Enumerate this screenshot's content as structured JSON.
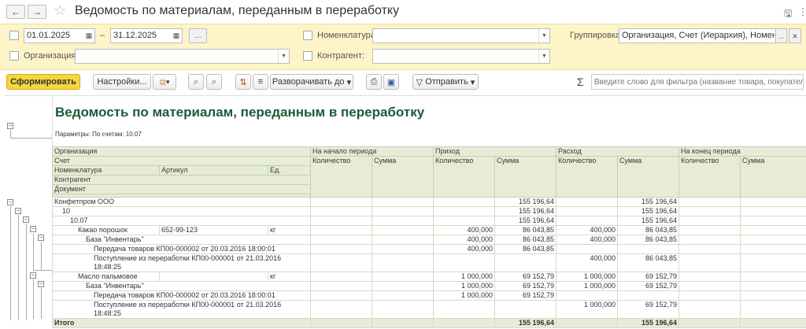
{
  "window": {
    "title": "Ведомость по материалам, переданным в переработку",
    "back_icon": "←",
    "forward_icon": "→",
    "star_icon": "☆",
    "save_icon": "🖫",
    "more_icon": "⋮"
  },
  "filters": {
    "date_from": "01.01.2025",
    "dash": "–",
    "date_to": "31.12.2025",
    "period_button": "...",
    "org_label": "Организация:",
    "org_value": "",
    "nom_label": "Номенклатура:",
    "nom_value": "",
    "contractor_label": "Контрагент:",
    "contractor_value": "",
    "grouping_label": "Группировка:",
    "grouping_value": "Организация, Счет (Иерархия), Номенклат",
    "grouping_btn": "...",
    "grouping_clear": "×"
  },
  "toolbar": {
    "generate": "Сформировать",
    "settings": "Настройки...",
    "expand": "Разворачивать до",
    "send": "Отправить",
    "sigma": "Σ",
    "search_placeholder": "Введите слово для фильтра (название товара, покупателя и"
  },
  "report": {
    "title": "Ведомость по материалам, переданным в переработку",
    "params": "Параметры: По счетам: 10.07",
    "header": {
      "org": "Организация",
      "account": "Счет",
      "nom": "Номенклатура",
      "article": "Артикул",
      "unit": "Ед.",
      "contractor": "Контрагент",
      "document": "Документ",
      "start": "На начало периода",
      "income": "Приход",
      "expense": "Расход",
      "end": "На конец периода",
      "qty": "Количество",
      "sum": "Сумма"
    },
    "rows": [
      {
        "label": "Конфетпром ООО",
        "article": "",
        "unit": "",
        "iq": "",
        "is": "155 196,64",
        "eq": "",
        "es": "155 196,64"
      },
      {
        "label": "10",
        "article": "",
        "unit": "",
        "iq": "",
        "is": "155 196,64",
        "eq": "",
        "es": "155 196,64"
      },
      {
        "label": "10.07",
        "article": "",
        "unit": "",
        "iq": "",
        "is": "155 196,64",
        "eq": "",
        "es": "155 196,64"
      },
      {
        "label": "Какао порошок",
        "article": "652-99-123",
        "unit": "кг",
        "iq": "400,000",
        "is": "86 043,85",
        "eq": "400,000",
        "es": "86 043,85"
      },
      {
        "label": "База \"Инвентарь\"",
        "article": "",
        "unit": "",
        "iq": "400,000",
        "is": "86 043,85",
        "eq": "400,000",
        "es": "86 043,85"
      },
      {
        "label": "Передача товаров КП00-000002 от 20.03.2016 18:00:01",
        "article": "",
        "unit": "",
        "iq": "400,000",
        "is": "86 043,85",
        "eq": "",
        "es": ""
      },
      {
        "label": "Поступление из переработки КП00-000001 от 21.03.2016",
        "label2": "18:48:25",
        "article": "",
        "unit": "",
        "iq": "",
        "is": "",
        "eq": "400,000",
        "es": "86 043,85"
      },
      {
        "label": "Масло пальмовое",
        "article": "",
        "unit": "кг",
        "iq": "1 000,000",
        "is": "69 152,79",
        "eq": "1 000,000",
        "es": "69 152,79"
      },
      {
        "label": "База \"Инвентарь\"",
        "article": "",
        "unit": "",
        "iq": "1 000,000",
        "is": "69 152,79",
        "eq": "1 000,000",
        "es": "69 152,79"
      },
      {
        "label": "Передача товаров КП00-000002 от 20.03.2016 18:00:01",
        "article": "",
        "unit": "",
        "iq": "1 000,000",
        "is": "69 152,79",
        "eq": "",
        "es": ""
      },
      {
        "label": "Поступление из переработки КП00-000001 от 21.03.2016",
        "label2": "18:48:25",
        "article": "",
        "unit": "",
        "iq": "",
        "is": "",
        "eq": "1 000,000",
        "es": "69 152,79"
      }
    ],
    "total": {
      "label": "Итого",
      "is": "155 196,64",
      "es": "155 196,64"
    }
  }
}
